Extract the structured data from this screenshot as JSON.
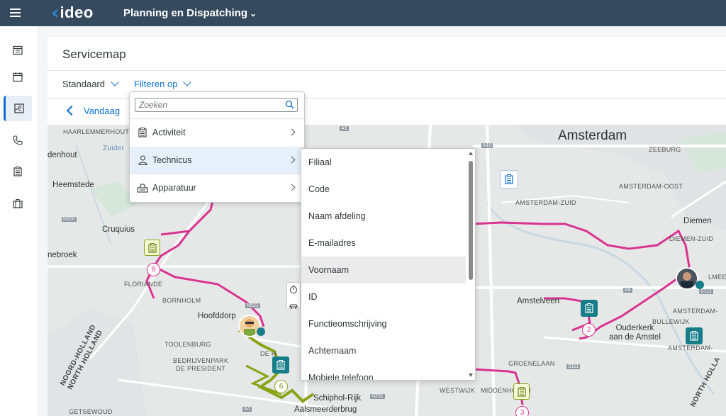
{
  "shell": {
    "logo_text": "ideo",
    "app_title": "Planning en Dispatching"
  },
  "sidebar": {
    "items": [
      {
        "icon": "calendar-plan-icon"
      },
      {
        "icon": "calendar-icon"
      },
      {
        "icon": "map-icon",
        "active": true
      },
      {
        "icon": "phone-icon"
      },
      {
        "icon": "clipboard-icon"
      },
      {
        "icon": "briefcase-icon"
      }
    ]
  },
  "page": {
    "title": "Servicemap",
    "variant_label": "Standaard",
    "filter_label": "Filteren op",
    "date_label": "Vandaag"
  },
  "filter_menu": {
    "search_placeholder": "Zoeken",
    "items": [
      {
        "label": "Activiteit",
        "icon": "clipboard-icon"
      },
      {
        "label": "Technicus",
        "icon": "person-icon",
        "selected": true
      },
      {
        "label": "Apparatuur",
        "icon": "equipment-icon"
      }
    ]
  },
  "submenu": {
    "items": [
      {
        "label": "Filiaal"
      },
      {
        "label": "Code"
      },
      {
        "label": "Naam afdeling"
      },
      {
        "label": "E-mailadres"
      },
      {
        "label": "Voornaam",
        "hover": true
      },
      {
        "label": "ID"
      },
      {
        "label": "Functieomschrijving"
      },
      {
        "label": "Achternaam"
      },
      {
        "label": "Mobiele telefoon"
      }
    ]
  },
  "map": {
    "cities": {
      "amsterdam": "Amsterdam"
    },
    "places": {
      "heemstede": "Heemstede",
      "cruquius": "Cruquius",
      "hoofddorp": "Hoofddorp",
      "amstelveen": "Amstelveen",
      "diemen": "Diemen",
      "ouderkerk": "Ouderkerk\naan de Amstel",
      "aalsmeerderbrug": "Aalsmeerderbrug",
      "schiphol_rijk": "Schiphol-Rijk",
      "hout": "denhout",
      "broek": "nebroek"
    },
    "labels": {
      "haarlemmerhoutkwartier": "HAARLEMMERHOUTKWARTIER",
      "floriande": "FLORIANDE",
      "bornholm": "BORNHOLM",
      "toolenburg": "TOOLENBURG",
      "bedrijvenpark": "BEDRIJVENPARK\nDE PRESIDENT",
      "getsewoud": "GETSEWOUD",
      "amsterdam_zuid": "AMSTERDAM-ZUID",
      "amsterdam_oost": "AMSTERDAM-OOST",
      "zeeburg": "ZEEBURG",
      "diemen_zuid": "DIEMEN-ZUID",
      "bullewijk": "BULLEWIJK",
      "amsterdam_partial": "AMSTERDAM-",
      "amsterdam_zuidoost_partial": "AMSTERDAM-",
      "groenelaan": "GROENELAAN",
      "westwijk": "WESTWIJK",
      "middenhoven": "MIDDENHOVEN",
      "amstel_partial": "AMSTERD",
      "de_hoek": "DE HOEK",
      "lmeer": "LMEER",
      "zuider": "Zuider",
      "hoek_partial": "DE H"
    },
    "regions": {
      "noord_holland_left": "NOORD-HOLLAND\nNORTH HOLLAND",
      "noord_holland_right": "NORTH HOLLA"
    },
    "roads": [
      "A5",
      "A10",
      "A9",
      "A4",
      "N200",
      "N201",
      "S112",
      "S111",
      "N521"
    ],
    "markers": [
      {
        "type": "green-activity",
        "number": "8"
      },
      {
        "type": "teal-activity",
        "number": "2"
      },
      {
        "type": "teal-activity",
        "number": "6"
      },
      {
        "type": "green-activity",
        "number": "3"
      },
      {
        "type": "white-activity"
      },
      {
        "type": "teal-activity"
      }
    ],
    "colors": {
      "route_pink": "#d8338f",
      "route_green": "#8ca318",
      "teal": "#177e89"
    },
    "bottom_partial": "Aalsmeer"
  }
}
